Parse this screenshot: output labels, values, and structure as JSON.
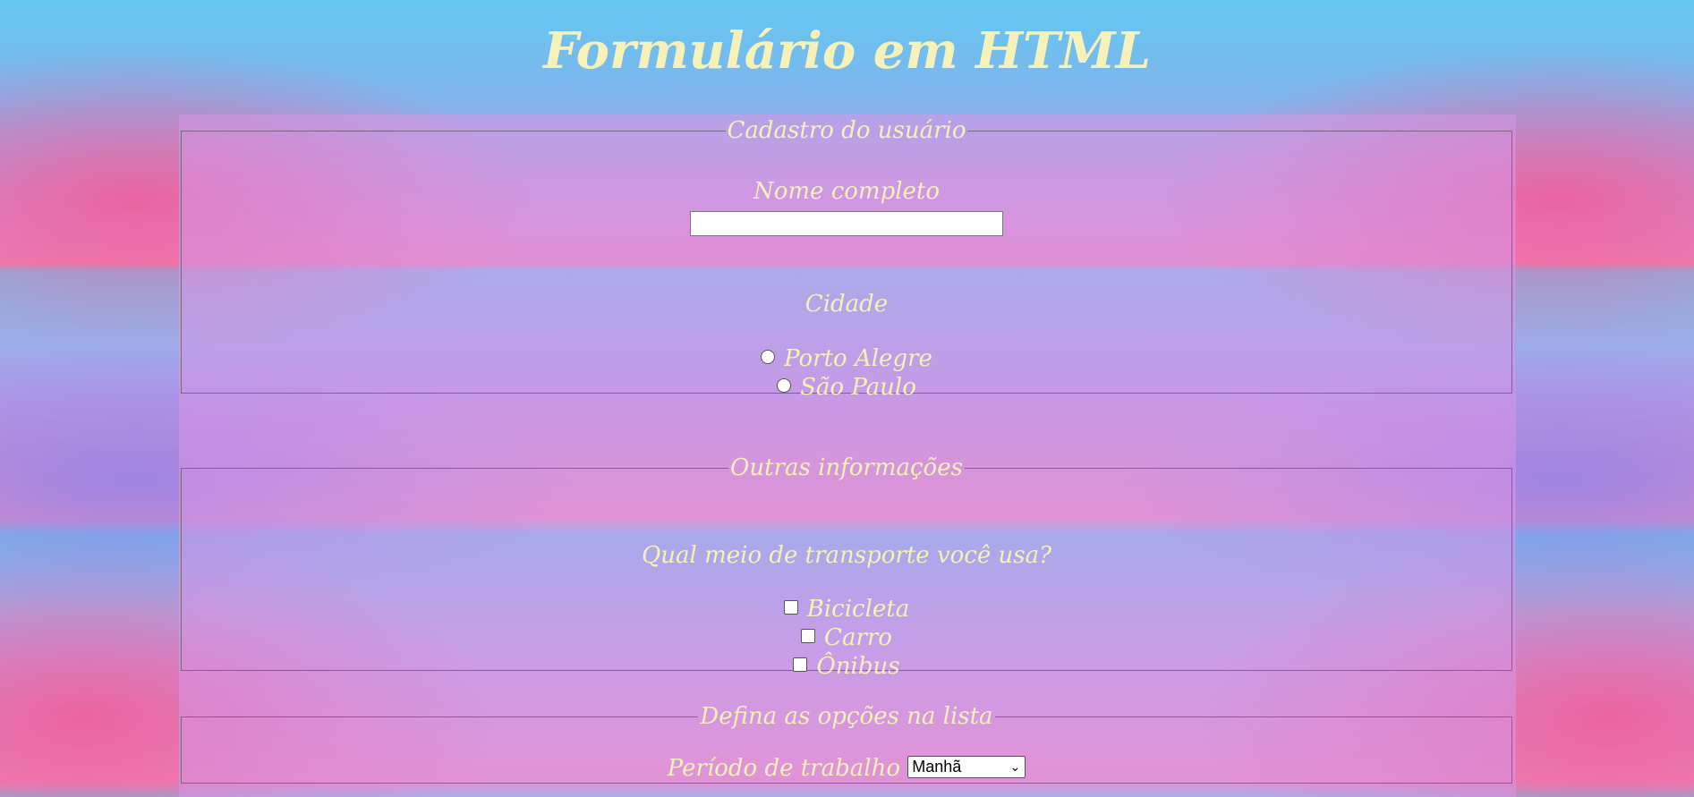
{
  "title": "Formulário em HTML",
  "section1": {
    "legend": "Cadastro do usuário",
    "name_label": "Nome completo",
    "name_value": "",
    "city_label": "Cidade",
    "city_options": [
      "Porto Alegre",
      "São Paulo"
    ]
  },
  "section2": {
    "legend": "Outras informações",
    "question": "Qual meio de transporte você usa?",
    "options": [
      "Bicicleta",
      "Carro",
      "Ônibus"
    ]
  },
  "section3": {
    "legend": "Defina as opções na lista",
    "period_label": "Período de trabalho",
    "period_selected": "Manhã"
  },
  "colors": {
    "text": "#f5f1b8",
    "panel": "#d796e6"
  }
}
